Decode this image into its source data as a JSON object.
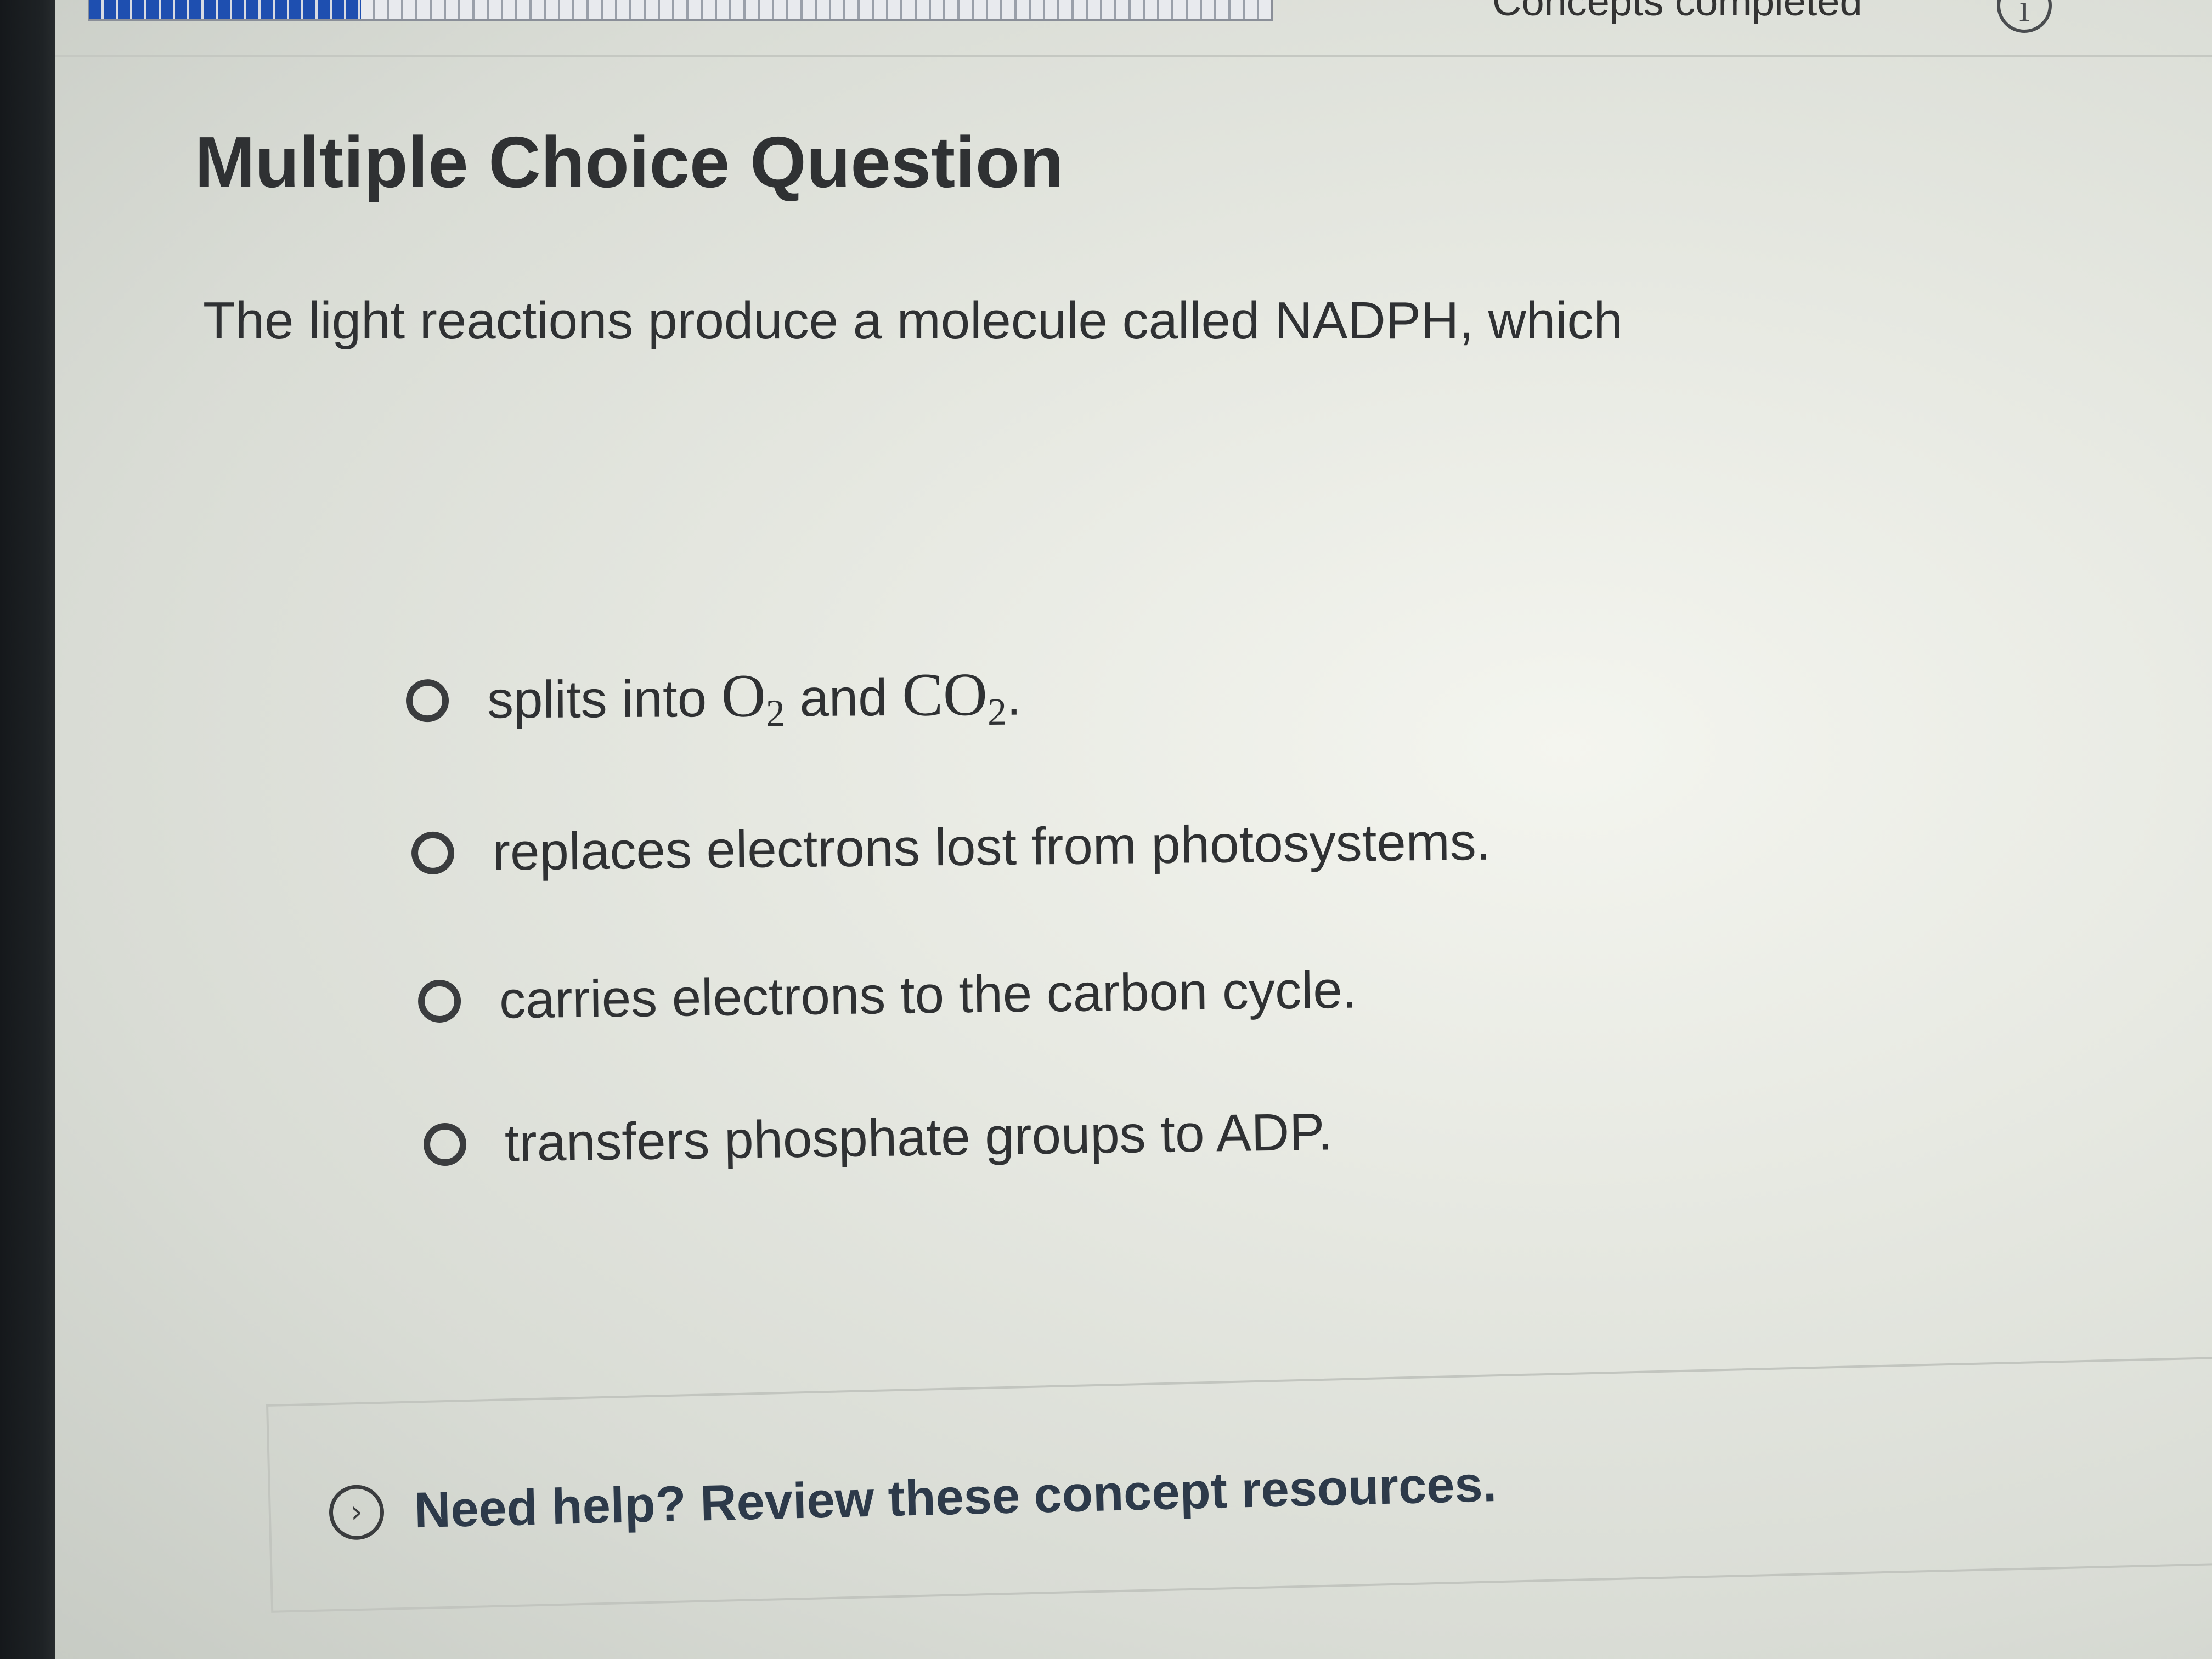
{
  "top_bar": {
    "progress_fraction": 0.23,
    "concepts_label": "Concepts completed",
    "info_icon": "info-icon"
  },
  "question": {
    "heading": "Multiple Choice Question",
    "prompt": "The light reactions produce a molecule called NADPH, which",
    "options": [
      {
        "text_before": "splits into ",
        "formula1_base": "O",
        "formula1_sub": "2",
        "text_mid": " and ",
        "formula2_base": "CO",
        "formula2_sub": "2",
        "text_after": "."
      },
      {
        "text": "replaces electrons lost from photosystems."
      },
      {
        "text": "carries electrons to the carbon cycle."
      },
      {
        "text": "transfers phosphate groups to ADP."
      }
    ]
  },
  "help": {
    "icon": "chevron-right-icon",
    "label": "Need help? Review these concept resources."
  },
  "colors": {
    "progress_blue": "#1e4fb0",
    "text": "#2f3133",
    "help_text": "#2d3a4a"
  }
}
